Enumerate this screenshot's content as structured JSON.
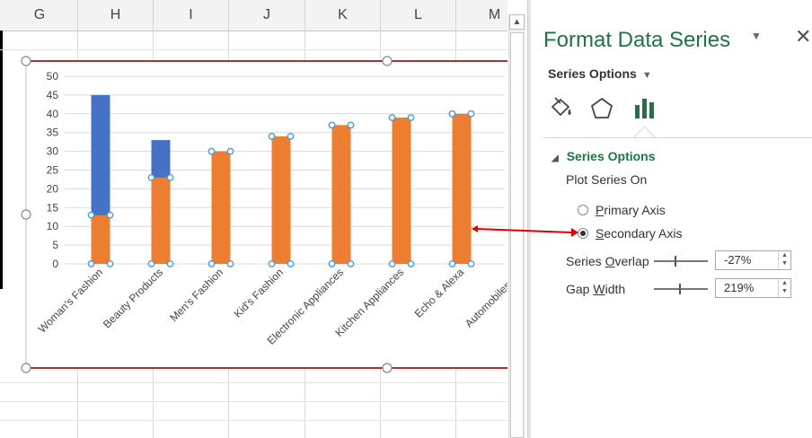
{
  "columns": [
    "G",
    "H",
    "I",
    "J",
    "K",
    "L",
    "M"
  ],
  "pane": {
    "title": "Format Data Series",
    "dropdown_icon": "triangle-down-icon",
    "close_icon": "close-icon",
    "series_options_dropdown": "Series Options",
    "tabs": [
      {
        "icon": "fill-bucket-icon"
      },
      {
        "icon": "pentagon-effects-icon"
      },
      {
        "icon": "bar-chart-options-icon"
      }
    ],
    "section_title": "Series Options",
    "plot_series_on": "Plot Series On",
    "primary_axis_label": "Primary Axis",
    "secondary_axis_label": "Secondary Axis",
    "selected_axis": "Secondary Axis",
    "series_overlap_label": "Series Overlap",
    "series_overlap_value": "-27%",
    "gap_width_label": "Gap Width",
    "gap_width_value": "219%",
    "accent_color": "#217346"
  },
  "chart_data": {
    "type": "bar",
    "categories": [
      "Woman's Fashion",
      "Beauty Products",
      "Men's Fashion",
      "Kid's Fashion",
      "Electronic Appliances",
      "Kitchen Appliances",
      "Echo & Alexa",
      "Automobiles pro"
    ],
    "series": [
      {
        "color": "#4472c4",
        "axis": "primary",
        "values": [
          45,
          33,
          null,
          null,
          null,
          null,
          null,
          null
        ]
      },
      {
        "color": "#ed7d31",
        "axis": "secondary",
        "values": [
          13,
          23,
          30,
          34,
          37,
          39,
          40,
          null
        ]
      }
    ],
    "yticks": [
      "50",
      "45",
      "40",
      "35",
      "30",
      "25",
      "20",
      "15",
      "10",
      "5",
      "0"
    ],
    "ylim": [
      0,
      50
    ],
    "grid": true,
    "arrow_color": "#e00000",
    "border_color": "#a83232"
  }
}
